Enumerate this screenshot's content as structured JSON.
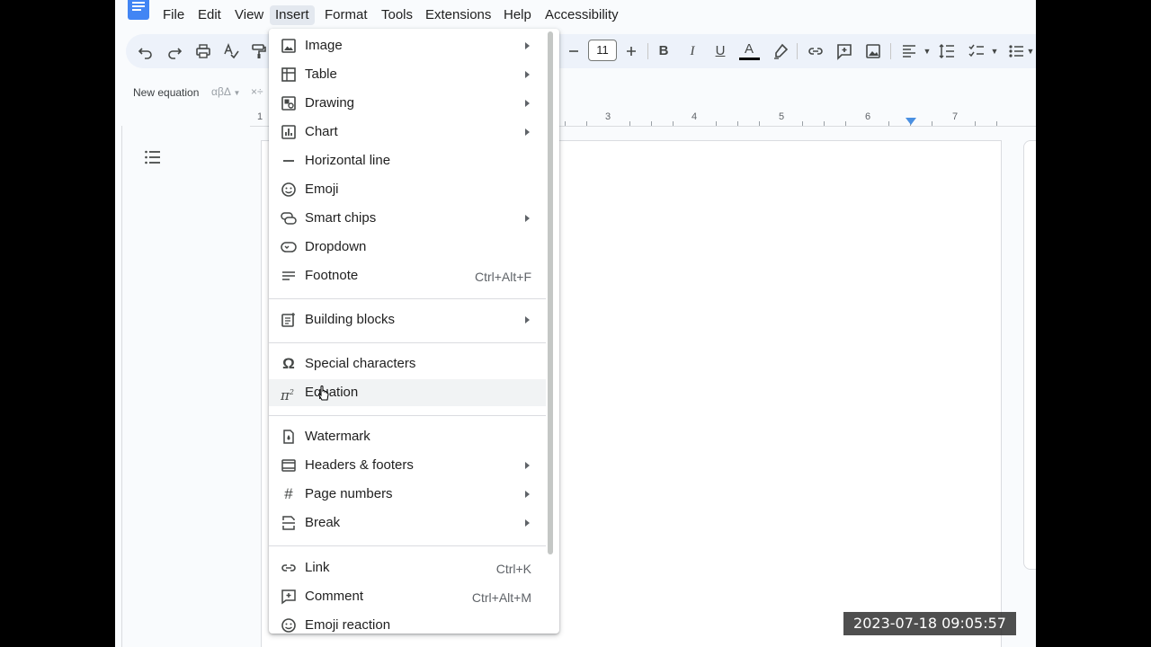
{
  "menubar": {
    "items": [
      "File",
      "Edit",
      "View",
      "Insert",
      "Format",
      "Tools",
      "Extensions",
      "Help",
      "Accessibility"
    ],
    "active": "Insert"
  },
  "toolbar": {
    "font_size": "11",
    "icons": [
      "undo-icon",
      "redo-icon",
      "print-icon",
      "spellcheck-icon",
      "paint-format-icon",
      "decrease-font-icon",
      "increase-font-icon",
      "bold-icon",
      "italic-icon",
      "underline-icon",
      "text-color-icon",
      "highlight-icon",
      "link-icon",
      "add-comment-icon",
      "insert-image-icon",
      "align-icon",
      "line-spacing-icon",
      "checklist-icon",
      "bulleted-list-icon"
    ],
    "bold_label": "B",
    "italic_label": "I",
    "underline_label": "U",
    "text_color_label": "A"
  },
  "equation_toolbar": {
    "new_equation": "New equation",
    "greek": "αβΔ",
    "ops": "×÷"
  },
  "ruler": {
    "numbers": [
      "1",
      "3",
      "4",
      "5",
      "6",
      "7"
    ]
  },
  "insert_menu": {
    "items": [
      {
        "label": "Image",
        "icon": "image-icon",
        "submenu": true,
        "shortcut": ""
      },
      {
        "label": "Table",
        "icon": "table-icon",
        "submenu": true,
        "shortcut": ""
      },
      {
        "label": "Drawing",
        "icon": "drawing-icon",
        "submenu": true,
        "shortcut": ""
      },
      {
        "label": "Chart",
        "icon": "chart-icon",
        "submenu": true,
        "shortcut": ""
      },
      {
        "label": "Horizontal line",
        "icon": "horizontal-line-icon",
        "submenu": false,
        "shortcut": ""
      },
      {
        "label": "Emoji",
        "icon": "emoji-icon",
        "submenu": false,
        "shortcut": ""
      },
      {
        "label": "Smart chips",
        "icon": "smart-chips-icon",
        "submenu": true,
        "shortcut": ""
      },
      {
        "label": "Dropdown",
        "icon": "dropdown-icon",
        "submenu": false,
        "shortcut": ""
      },
      {
        "label": "Footnote",
        "icon": "footnote-icon",
        "submenu": false,
        "shortcut": "Ctrl+Alt+F"
      },
      {
        "label": "Building blocks",
        "icon": "building-blocks-icon",
        "submenu": true,
        "shortcut": ""
      },
      {
        "label": "Special characters",
        "icon": "omega-icon",
        "submenu": false,
        "shortcut": ""
      },
      {
        "label": "Equation",
        "icon": "pi-squared-icon",
        "submenu": false,
        "shortcut": ""
      },
      {
        "label": "Watermark",
        "icon": "watermark-icon",
        "submenu": false,
        "shortcut": ""
      },
      {
        "label": "Headers & footers",
        "icon": "headers-footers-icon",
        "submenu": true,
        "shortcut": ""
      },
      {
        "label": "Page numbers",
        "icon": "hash-icon",
        "submenu": true,
        "shortcut": ""
      },
      {
        "label": "Break",
        "icon": "break-icon",
        "submenu": true,
        "shortcut": ""
      },
      {
        "label": "Link",
        "icon": "link-icon",
        "submenu": false,
        "shortcut": "Ctrl+K"
      },
      {
        "label": "Comment",
        "icon": "comment-icon",
        "submenu": false,
        "shortcut": "Ctrl+Alt+M"
      },
      {
        "label": "Emoji reaction",
        "icon": "emoji-reaction-icon",
        "submenu": false,
        "shortcut": ""
      }
    ],
    "hovered": "Equation"
  },
  "timestamp": "2023-07-18 09:05:57",
  "colors": {
    "app_bg": "#f9fbfd",
    "toolbar_bg": "#edf2fa",
    "menu_active_bg": "#e3e8ef",
    "accent_blue": "#4285f4",
    "ruler_marker": "#4a90e2"
  }
}
